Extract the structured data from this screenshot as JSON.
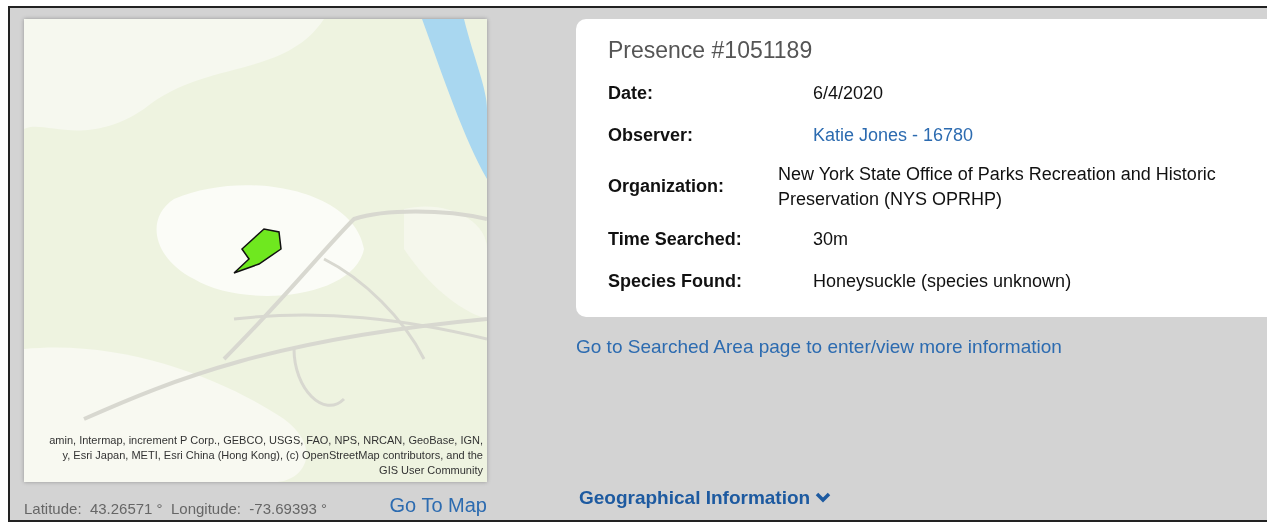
{
  "map": {
    "kind": "picture",
    "attribution": [
      "amin, Intermap, increment P Corp., GEBCO, USGS, FAO, NPS, NRCAN, GeoBase, IGN,",
      "y, Esri Japan, METI, Esri China (Hong Kong), (c) OpenStreetMap contributors, and the",
      "GIS User Community"
    ]
  },
  "coordinates": {
    "latitude_label": "Latitude:",
    "latitude": "43.26571 °",
    "longitude_label": "Longitude:",
    "longitude": "-73.69393 °"
  },
  "go_to_map": "Go To Map",
  "presence": {
    "title": "Presence #1051189",
    "fields": [
      {
        "kind": "text",
        "label": "Date:",
        "value": "6/4/2020"
      },
      {
        "kind": "link",
        "label": "Observer:",
        "value": "Katie Jones - 16780"
      },
      {
        "kind": "long",
        "label": "Organization:",
        "value": "New York State Office of Parks Recreation and Historic Preservation (NYS OPRHP)"
      },
      {
        "kind": "text",
        "label": "Time Searched:",
        "value": "30m"
      },
      {
        "kind": "text",
        "label": "Species Found:",
        "value": "Honeysuckle (species unknown)"
      }
    ]
  },
  "searched_area_link": "Go to Searched Area page to enter/view more information",
  "geo_section": {
    "label": "Geographical Information"
  }
}
